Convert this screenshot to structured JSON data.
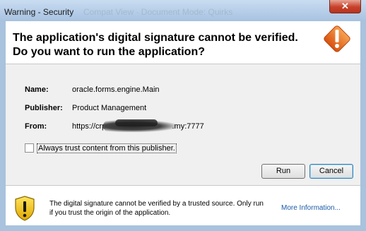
{
  "window": {
    "title": "Warning - Security",
    "background_title": "Compat View · Document Mode: Quirks",
    "close_glyph": "✕"
  },
  "header": {
    "title_line1": "The application's digital signature cannot be verified.",
    "title_line2": "Do you want to run the application?",
    "icon": "warning-diamond-icon"
  },
  "details": {
    "name_label": "Name:",
    "name_value": "oracle.forms.engine.Main",
    "publisher_label": "Publisher:",
    "publisher_value": "Product Management",
    "from_label": "From:",
    "from_prefix": "https://crp-c",
    "from_suffix": ".my:7777"
  },
  "checkbox": {
    "label": "Always trust content from this publisher.",
    "checked": false
  },
  "buttons": {
    "run": "Run",
    "cancel": "Cancel"
  },
  "footer": {
    "icon": "shield-warning-icon",
    "text": "The digital signature cannot be verified by a trusted source.  Only run if you trust the origin of the application.",
    "link": "More Information..."
  },
  "colors": {
    "title_bar": "#a9c4e2",
    "close_button": "#c7412a",
    "warning_orange": "#e8641b",
    "shield_yellow": "#f2c500",
    "link": "#1a5aa6"
  }
}
